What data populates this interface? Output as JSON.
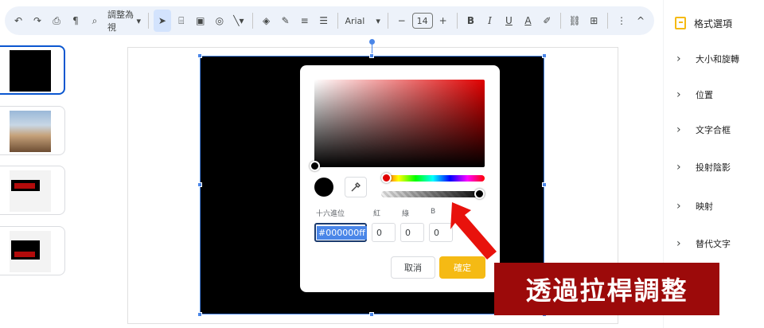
{
  "toolbar": {
    "undo_icon": "undo-icon",
    "redo_icon": "redo-icon",
    "print_icon": "print-icon",
    "paint_format_icon": "paint-format-icon",
    "zoom_icon": "zoom-icon",
    "zoom_label": "調整為視",
    "font_family": "Arial",
    "font_size": "14",
    "bold": "B",
    "italic": "I",
    "underline": "U",
    "text_color": "A",
    "more": "⋮",
    "collapse": "^"
  },
  "right_panel": {
    "title": "格式選項",
    "sections": [
      "大小和旋轉",
      "位置",
      "文字合框",
      "投射陰影",
      "映射",
      "替代文字"
    ]
  },
  "color_dialog": {
    "hex_label": "十六進位",
    "r_label": "紅",
    "g_label": "綠",
    "b_label": "B",
    "hex_value": "#000000ff",
    "r_value": "0",
    "g_value": "0",
    "b_value": "0",
    "cancel_label": "取消",
    "ok_label": "確定",
    "hue_fraction": 0.0,
    "alpha_fraction": 1.0,
    "selected_color": "#000000"
  },
  "annotation": {
    "text": "透過拉桿調整",
    "color": "#9c0a0a",
    "arrow_color": "#e8120c"
  },
  "thumbnails": [
    {
      "kind": "black-slide",
      "selected": true
    },
    {
      "kind": "photo-slide",
      "selected": false
    },
    {
      "kind": "screenshot-slide",
      "selected": false
    },
    {
      "kind": "screenshot-slide",
      "selected": false
    }
  ]
}
